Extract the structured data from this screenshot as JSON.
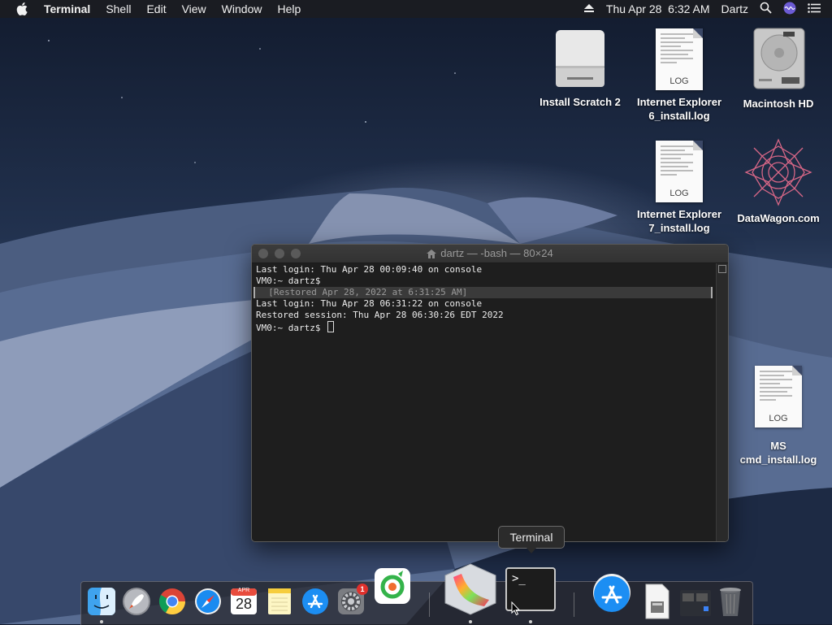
{
  "menubar": {
    "apple_icon": "apple-logo-icon",
    "app_name": "Terminal",
    "menus": [
      "Shell",
      "Edit",
      "View",
      "Window",
      "Help"
    ],
    "clock": "Thu Apr 28  6:32 AM",
    "user": "Dartz",
    "status_icons": [
      "eject-icon",
      "spotlight-search-icon",
      "siri-icon",
      "notification-center-icon"
    ]
  },
  "desktop_icons": [
    {
      "label": "Install Scratch 2",
      "kind": "disk-image"
    },
    {
      "label": "Internet Explorer 6_install.log",
      "line1": "Internet Explorer",
      "line2": "6_install.log",
      "kind": "log",
      "tag": "LOG"
    },
    {
      "label": "Macintosh HD",
      "kind": "hard-drive"
    },
    {
      "label": "Internet Explorer 7_install.log",
      "line1": "Internet Explorer",
      "line2": "7_install.log",
      "kind": "log",
      "tag": "LOG"
    },
    {
      "label": "DataWagon.com",
      "kind": "logo"
    },
    {
      "label": "MS cmd_install.log",
      "line1": "MS",
      "line2": "cmd_install.log",
      "kind": "log",
      "tag": "LOG"
    }
  ],
  "terminal": {
    "title": "dartz — -bash — 80×24",
    "lines": [
      "Last login: Thu Apr 28 00:09:40 on console",
      "VM0:~ dartz$",
      "  [Restored Apr 28, 2022 at 6:31:25 AM]",
      "Last login: Thu Apr 28 06:31:22 on console",
      "Restored session: Thu Apr 28 06:30:26 EDT 2022",
      "VM0:~ dartz$ "
    ]
  },
  "tooltip": "Terminal",
  "dock": {
    "items": [
      "Finder",
      "Launchpad",
      "Google Chrome",
      "Safari",
      "Calendar",
      "Notes",
      "App Store",
      "System Preferences",
      "CleanMyMac",
      "Grapher",
      "Terminal",
      "App Store Downloads",
      "Preview",
      "Documents",
      "Trash"
    ],
    "calendar_month": "APR",
    "calendar_day": "28",
    "sys_prefs_badge": "1",
    "terminal_prompt": ">_"
  }
}
